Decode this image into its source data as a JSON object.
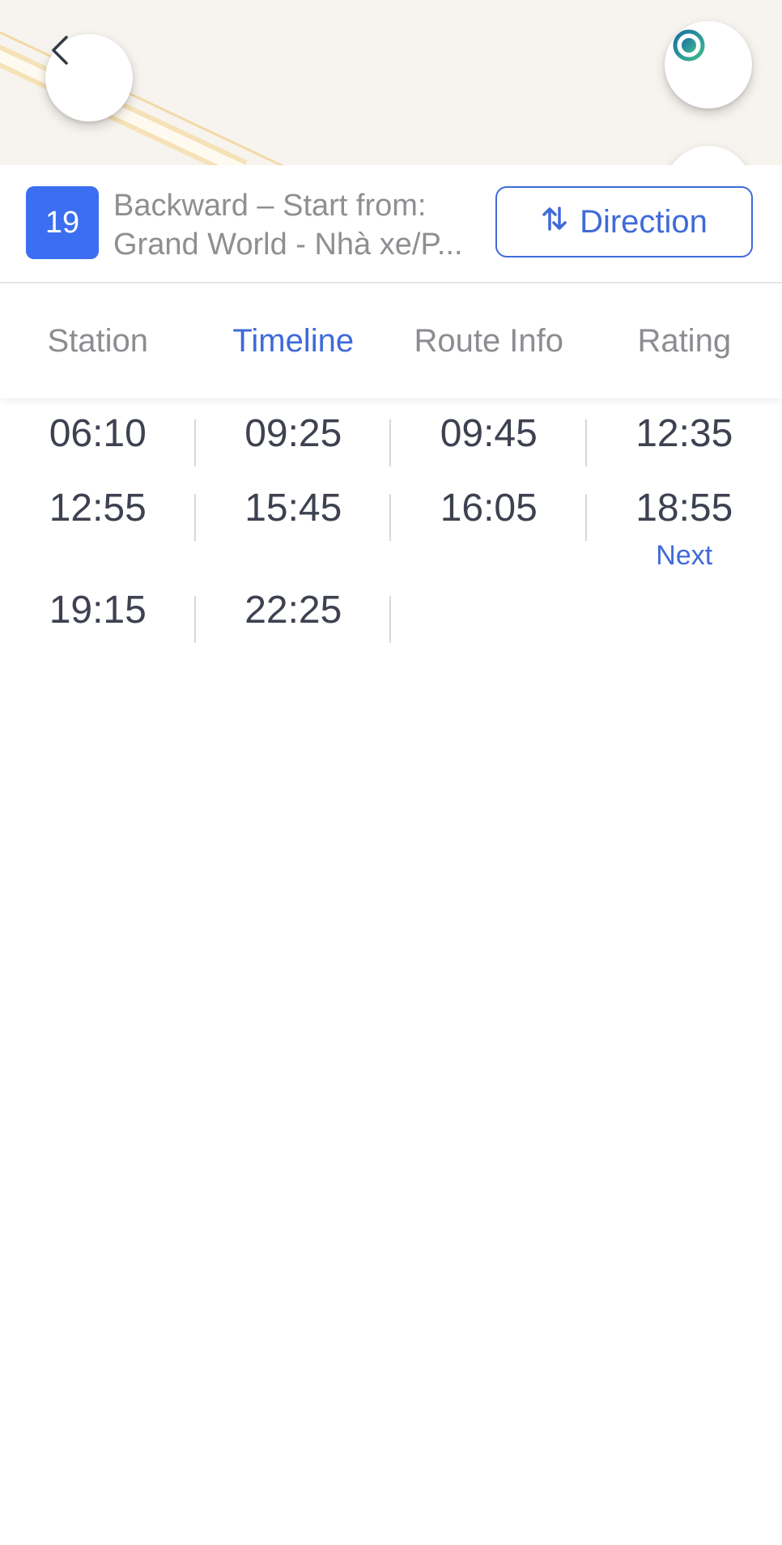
{
  "route": {
    "number": "19",
    "line1": "Backward – Start from:",
    "line2": "Grand World - Nhà xe/P...",
    "direction_label": "Direction"
  },
  "tabs": [
    {
      "label": "Station"
    },
    {
      "label": "Timeline"
    },
    {
      "label": "Route Info"
    },
    {
      "label": "Rating"
    }
  ],
  "timeline": {
    "rows": [
      [
        "06:10",
        "09:25",
        "09:45",
        "12:35"
      ],
      [
        "12:55",
        "15:45",
        "16:05",
        "18:55"
      ],
      [
        "19:15",
        "22:25"
      ]
    ],
    "next_label": "Next"
  },
  "colors": {
    "accent": "#3f6ad8",
    "badge": "#3b6ef0",
    "locate_icon": "#1f8aa6"
  },
  "icons": {
    "back": "chevron-left-icon",
    "locate": "crosshair-icon",
    "direction": "swap-vertical-icon"
  }
}
